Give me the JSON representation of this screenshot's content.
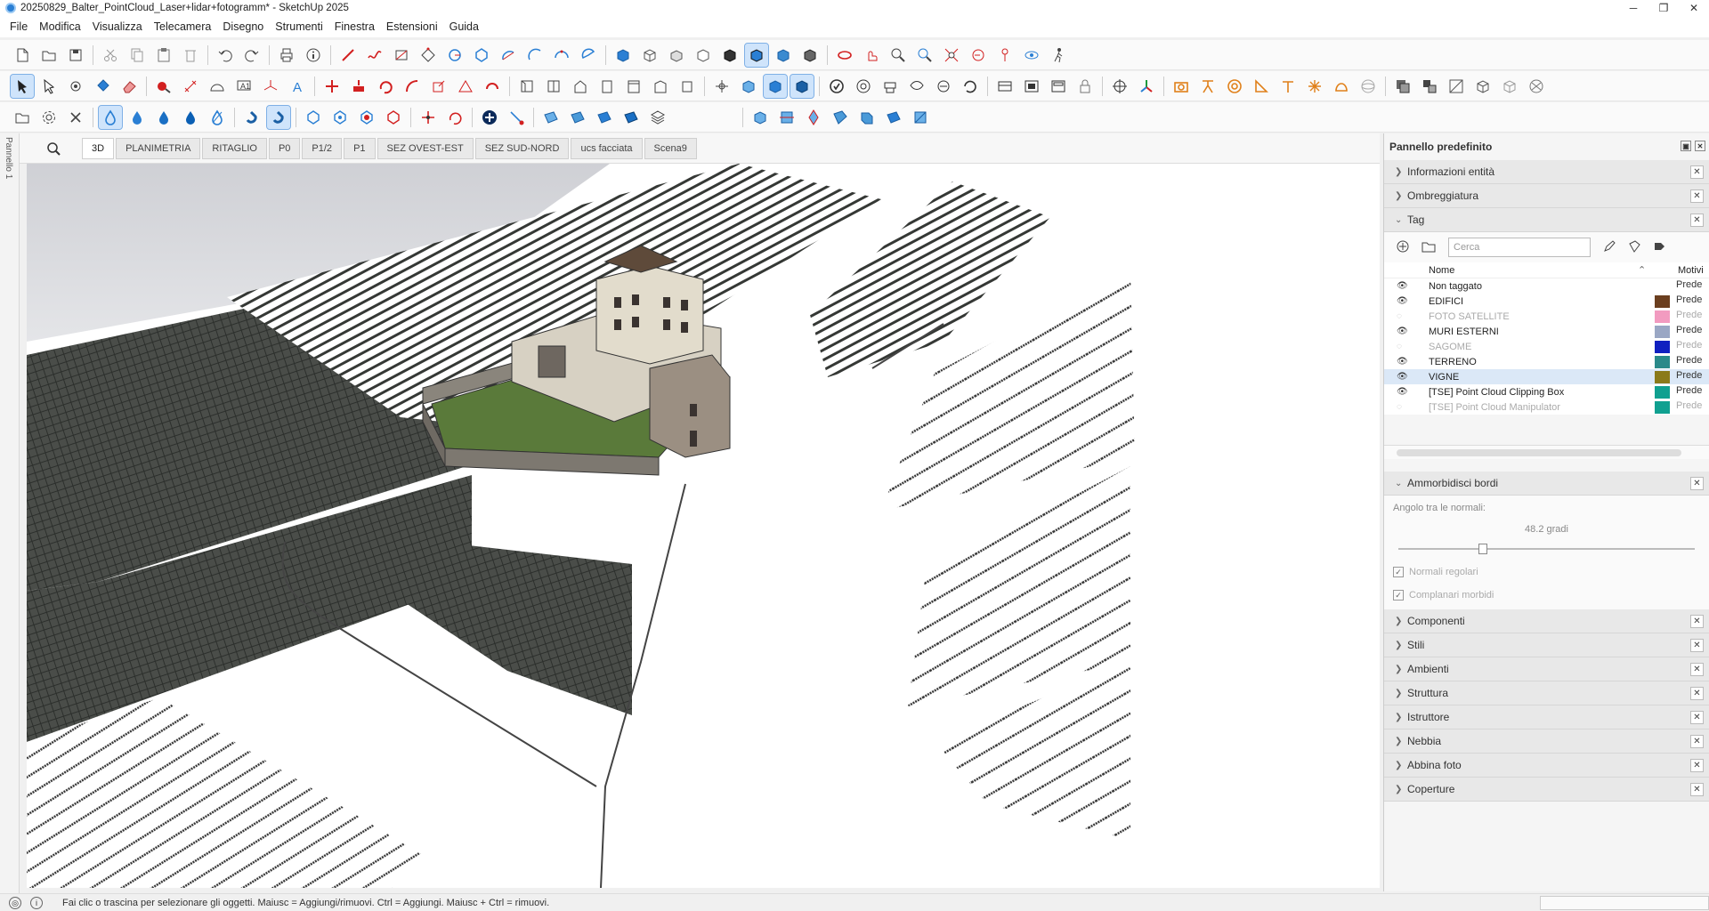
{
  "window": {
    "title": "20250829_Balter_PointCloud_Laser+lidar+fotogramm* - SketchUp 2025",
    "controls": [
      "─",
      "❐",
      "✕"
    ]
  },
  "menu": [
    "File",
    "Modifica",
    "Visualizza",
    "Telecamera",
    "Disegno",
    "Strumenti",
    "Finestra",
    "Estensioni",
    "Guida"
  ],
  "left_panel_label": "Pannello 1",
  "scenes": {
    "active": "3D",
    "tabs": [
      "3D",
      "PLANIMETRIA",
      "RITAGLIO",
      "P0",
      "P1/2",
      "P1",
      "SEZ OVEST-EST",
      "SEZ SUD-NORD",
      "ucs facciata",
      "Scena9"
    ]
  },
  "tray": {
    "title": "Pannello predefinito",
    "sections_top": [
      {
        "label": "Informazioni entità",
        "expanded": false
      },
      {
        "label": "Ombreggiatura",
        "expanded": false
      },
      {
        "label": "Tag",
        "expanded": true
      }
    ],
    "tags": {
      "search_placeholder": "Cerca",
      "col_name": "Nome",
      "col_pattern": "Motivi",
      "rows": [
        {
          "name": "Non taggato",
          "visible": true,
          "color": "",
          "pattern": "Prede"
        },
        {
          "name": "EDIFICI",
          "visible": true,
          "color": "#6b3f1f",
          "pattern": "Prede"
        },
        {
          "name": "FOTO SATELLITE",
          "visible": false,
          "color": "#f29bc0",
          "pattern": "Prede"
        },
        {
          "name": "MURI ESTERNI",
          "visible": true,
          "color": "#9aa7c4",
          "pattern": "Prede"
        },
        {
          "name": "SAGOME",
          "visible": false,
          "color": "#1020c0",
          "pattern": "Prede"
        },
        {
          "name": "TERRENO",
          "visible": true,
          "color": "#2a8a8a",
          "pattern": "Prede"
        },
        {
          "name": "VIGNE",
          "visible": true,
          "color": "#8a7a1a",
          "pattern": "Prede",
          "selected": true
        },
        {
          "name": "[TSE] Point Cloud Clipping Box",
          "visible": true,
          "color": "#10a090",
          "pattern": "Prede"
        },
        {
          "name": "[TSE] Point Cloud Manipulator",
          "visible": false,
          "color": "#10a090",
          "pattern": "Prede"
        }
      ]
    },
    "ammorbidisci": {
      "label": "Ammorbidisci bordi",
      "angle_label": "Angolo tra le normali:",
      "angle_value": "48.2  gradi",
      "angle_fraction": 0.27,
      "check1": "Normali regolari",
      "check2": "Complanari morbidi"
    },
    "sections_bottom": [
      "Componenti",
      "Stili",
      "Ambienti",
      "Struttura",
      "Istruttore",
      "Nebbia",
      "Abbina foto",
      "Coperture"
    ]
  },
  "status": {
    "message": "Fai clic o trascina per selezionare gli oggetti. Maiusc = Aggiungi/rimuovi. Ctrl = Aggiungi. Maiusc + Ctrl = rimuovi."
  },
  "colors": {
    "accent_red": "#d22020",
    "accent_blue": "#2a7fd4",
    "vine_dark": "#3a3d3a",
    "castle_wall": "#6f6a63",
    "lawn": "#5a7a3a"
  }
}
